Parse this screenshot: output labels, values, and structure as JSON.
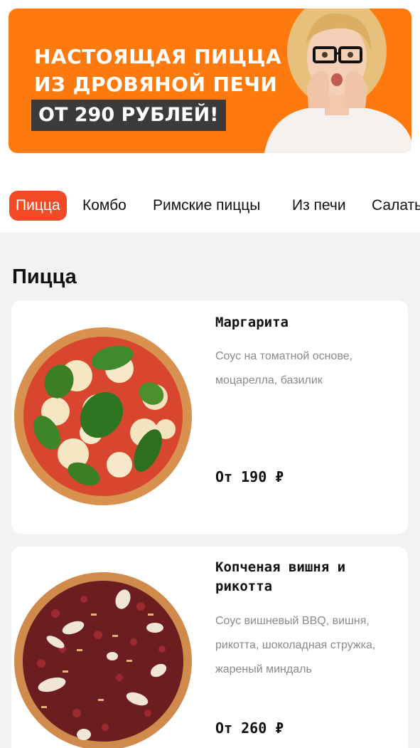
{
  "banner": {
    "line1": "НАСТОЯЩАЯ ПИЦЦА",
    "line2": "ИЗ ДРОВЯНОЙ ПЕЧИ",
    "price": "ОТ 290 РУБЛЕЙ!",
    "bg_color": "#ff7a0e"
  },
  "categories": [
    {
      "label": "Пицца",
      "active": true
    },
    {
      "label": "Комбо",
      "active": false
    },
    {
      "label": "Римские пиццы",
      "active": false
    },
    {
      "label": "Из печи",
      "active": false
    },
    {
      "label": "Салаты",
      "active": false
    }
  ],
  "accent_color": "#f04a27",
  "section": {
    "title": "Пицца"
  },
  "products": [
    {
      "name": "Маргарита",
      "description_lines": [
        "Соус на томатной основе,",
        "моцарелла, базилик"
      ],
      "price": "От 190 ₽"
    },
    {
      "name": "Копченая вишня и рикотта",
      "description_lines": [
        "Соус вишневый BBQ, вишня,",
        "рикотта, шоколадная стружка,",
        "жареный миндаль"
      ],
      "price": "От 260 ₽"
    }
  ]
}
